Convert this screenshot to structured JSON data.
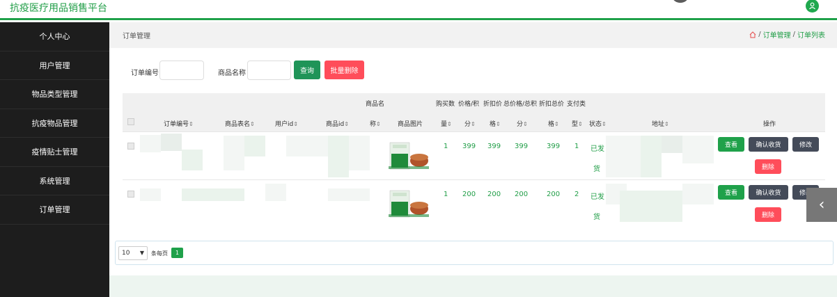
{
  "app": {
    "title": "抗疫医疗用品销售平台"
  },
  "sidebar": {
    "items": [
      {
        "label": "个人中心"
      },
      {
        "label": "用户管理"
      },
      {
        "label": "物品类型管理"
      },
      {
        "label": "抗疫物品管理"
      },
      {
        "label": "疫情贴士管理"
      },
      {
        "label": "系统管理"
      },
      {
        "label": "订单管理"
      }
    ]
  },
  "breadcrumb": {
    "title": "订单管理",
    "path": [
      "订单管理",
      "订单列表"
    ]
  },
  "search": {
    "order_no_label": "订单编号",
    "order_no_value": "",
    "product_name_label": "商品名称",
    "product_name_value": "",
    "query_button": "查询",
    "batch_delete_button": "批量删除"
  },
  "table": {
    "top_headers": [
      "商品名",
      "购买数",
      "价格/积",
      "折扣价",
      "总价格/总积",
      "折扣总价",
      "支付类"
    ],
    "headers": [
      "订单编号",
      "商品表名",
      "用户id",
      "商品id",
      "称",
      "商品图片",
      "量",
      "分",
      "格",
      "分",
      "格",
      "型",
      "状态",
      "地址",
      "操作"
    ],
    "rows": [
      {
        "qty": "1",
        "price": "399",
        "discount": "399",
        "total": "399",
        "discount_total": "399",
        "pay_type": "1",
        "status_1": "已发",
        "status_2": "货"
      },
      {
        "qty": "1",
        "price": "200",
        "discount": "200",
        "total": "200",
        "discount_total": "200",
        "pay_type": "2",
        "status_1": "已发",
        "status_2": "货"
      }
    ],
    "actions": {
      "view": "查看",
      "confirm": "确认收货",
      "edit": "修改",
      "delete": "删除"
    }
  },
  "pagination": {
    "page_size": "10",
    "per_page_label": "条每页",
    "current_page": "1"
  },
  "colors": {
    "accent": "#1fa14a",
    "danger": "#ff4d5a",
    "dark_button": "#444b59",
    "sidebar": "#1d1d1d"
  }
}
